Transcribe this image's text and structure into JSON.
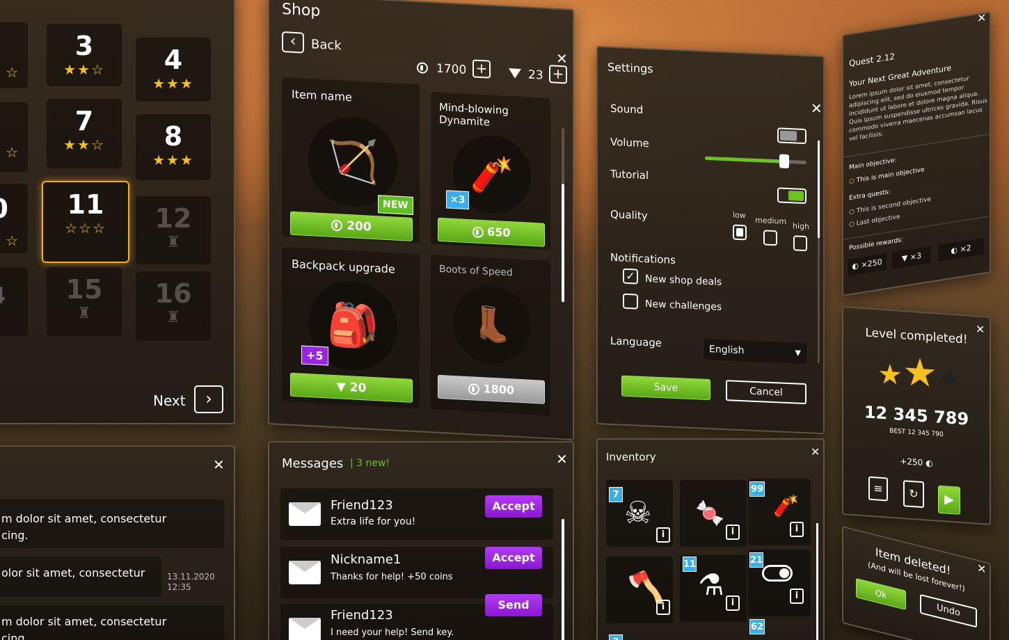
{
  "levels": {
    "next_label": "Next",
    "tiles": [
      {
        "num": "3",
        "stars": "★★☆"
      },
      {
        "num": "4",
        "stars": "★★★"
      },
      {
        "num": "7",
        "stars": "★★☆"
      },
      {
        "num": "8",
        "stars": "★★★"
      },
      {
        "num": "11",
        "stars": "☆☆☆"
      },
      {
        "num": "12",
        "stars": ""
      },
      {
        "num": "15",
        "stars": ""
      },
      {
        "num": "16",
        "stars": ""
      }
    ],
    "left_partial": [
      "0",
      "4"
    ]
  },
  "shop": {
    "title": "Shop",
    "back_label": "Back",
    "coins": "1700",
    "gems": "23",
    "items": [
      {
        "name": "Item name",
        "price": "200",
        "badge": "NEW",
        "currency": "coin"
      },
      {
        "name": "Mind-blowing Dynamite",
        "price": "650",
        "badge": "×3",
        "currency": "coin"
      },
      {
        "name": "Backpack upgrade",
        "price": "20",
        "badge": "+5",
        "currency": "gem"
      },
      {
        "name": "Boots of Speed",
        "price": "1800",
        "badge": "",
        "currency": "coin"
      }
    ]
  },
  "settings": {
    "title": "Settings",
    "sound_label": "Sound",
    "volume_label": "Volume",
    "tutorial_label": "Tutorial",
    "quality_label": "Quality",
    "quality_options": [
      "low",
      "medium",
      "high"
    ],
    "notifications_label": "Notifications",
    "notif_options": [
      {
        "label": "New shop deals",
        "checked": true
      },
      {
        "label": "New challenges",
        "checked": false
      }
    ],
    "language_label": "Language",
    "language_value": "English",
    "save_label": "Save",
    "cancel_label": "Cancel",
    "volume_level": 0.78
  },
  "quest": {
    "id": "Quest 2.12",
    "title": "Your Next Great Adventure",
    "body": "Lorem ipsum dolor sit amet, consectetur adipiscing elit, sed do eiusmod tempor incididunt ut labore et dolore magna aliqua. Quis ipsum suspendisse ultrices gravida. Risus commodo viverra maecenas accumsan lacus vel facilisis.",
    "main_obj_label": "Main objective:",
    "main_obj": "This is main objective",
    "extra_label": "Extra quests:",
    "extra": [
      "This is second objective",
      "Last objective"
    ],
    "rewards_label": "Possible rewards:",
    "rewards": [
      "×250",
      "×3",
      "×2"
    ]
  },
  "level_complete": {
    "title": "Level completed!",
    "score": "12 345 789",
    "best": "BEST 12 345 790",
    "bonus": "+250"
  },
  "deleted": {
    "title": "Item deleted!",
    "subtitle": "(And will be lost forever!)",
    "ok_label": "Ok",
    "undo_label": "Undo"
  },
  "messages": {
    "title": "Messages",
    "new_count": "3 new!",
    "items": [
      {
        "from": "Friend123",
        "text": "Extra life for you!",
        "action": "Accept"
      },
      {
        "from": "Nickname1",
        "text": "Thanks for help! +50 coins",
        "action": "Accept"
      },
      {
        "from": "Friend123",
        "text": "I need your help! Send key.",
        "action": "Send"
      }
    ]
  },
  "chat": {
    "lines": [
      "m dolor sit amet, consectetur",
      "cing.",
      "olor sit amet, consectetur",
      "m dolor sit amet, consectetur",
      "cing."
    ],
    "date": "13.11.2020",
    "time": "12:35"
  },
  "inventory": {
    "title": "Inventory",
    "counts": [
      "7",
      "99",
      "11",
      "21",
      "62",
      "3"
    ]
  },
  "colors": {
    "accent_green": "#6cc221",
    "accent_purple": "#9a25e0",
    "star_gold": "#f5c020",
    "badge_blue": "#3aaee8"
  }
}
